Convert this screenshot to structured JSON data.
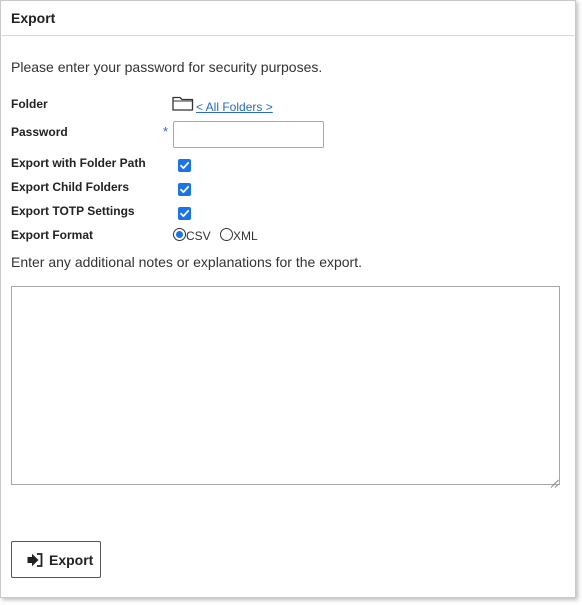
{
  "dialog": {
    "title": "Export"
  },
  "intro_text": "Please enter your password for security purposes.",
  "form": {
    "folder": {
      "label": "Folder",
      "link_text": "< All Folders >",
      "icon": "folder-icon"
    },
    "password": {
      "label": "Password",
      "required_mark": "*",
      "value": ""
    },
    "export_with_folder_path": {
      "label": "Export with Folder Path",
      "checked": true
    },
    "export_child_folders": {
      "label": "Export Child Folders",
      "checked": true
    },
    "export_totp_settings": {
      "label": "Export TOTP Settings",
      "checked": true
    },
    "export_format": {
      "label": "Export Format",
      "options": [
        {
          "label": "CSV",
          "selected": true
        },
        {
          "label": "XML",
          "selected": false
        }
      ]
    }
  },
  "notes": {
    "prompt": "Enter any additional notes or explanations for the export.",
    "value": ""
  },
  "actions": {
    "export_label": "Export",
    "export_icon": "sign-out-icon"
  },
  "colors": {
    "accent": "#1a73e8",
    "link": "#2a6bbf"
  }
}
